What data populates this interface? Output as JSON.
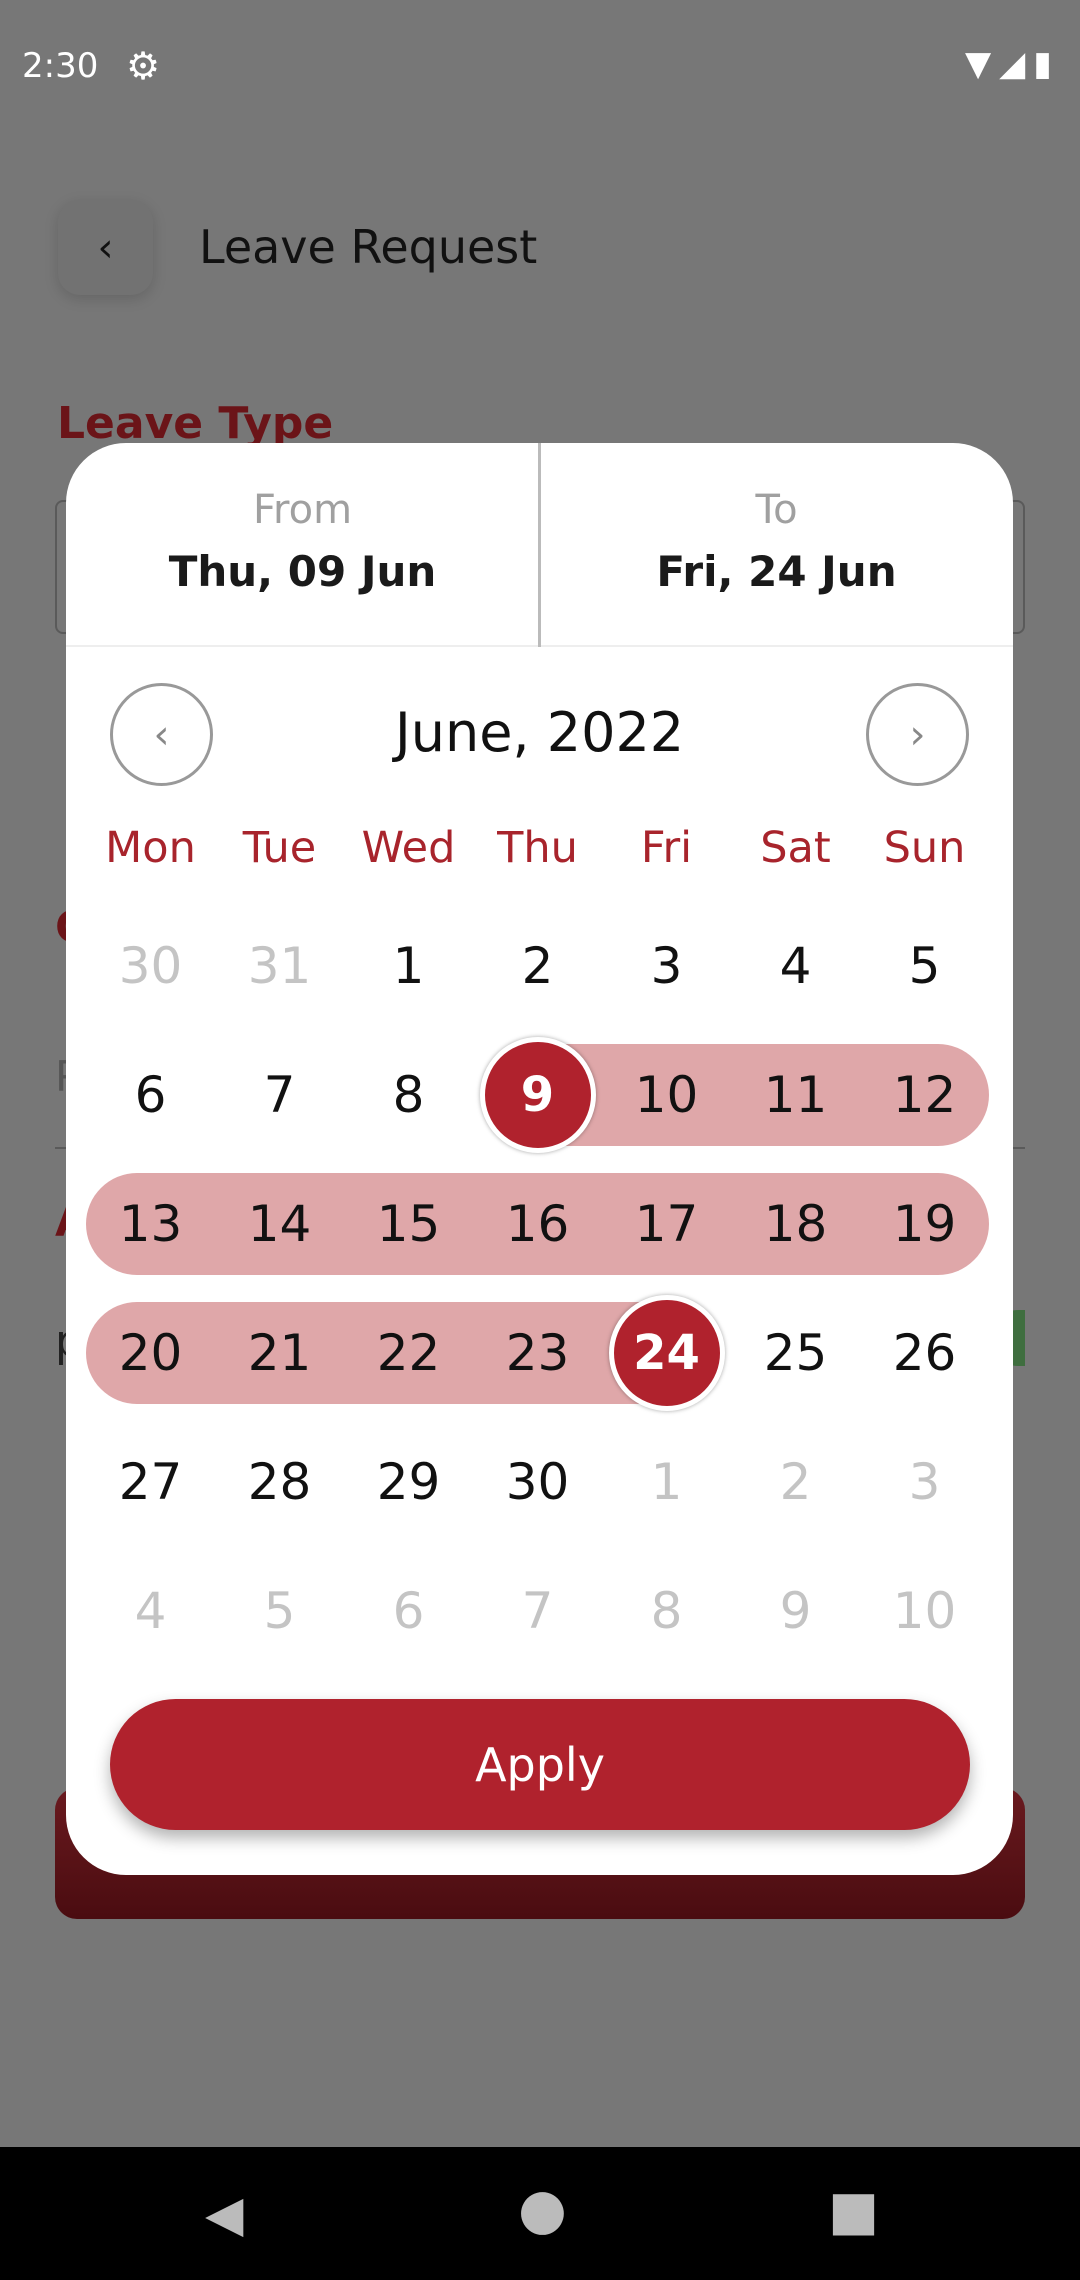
{
  "status_bar": {
    "time": "2:30",
    "settings_icon": "gear-icon",
    "wifi_icon": "wifi-icon",
    "signal_icon": "signal-icon",
    "battery_icon": "battery-icon"
  },
  "header": {
    "title": "Leave Request",
    "back_icon": "chevron-left-icon"
  },
  "background": {
    "leave_type_label": "Leave Type",
    "fragment_c": "C",
    "fragment_p": "P",
    "fragment_a": "A",
    "fragment_p2": "p"
  },
  "picker": {
    "from_label": "From",
    "from_value": "Thu, 09 Jun",
    "to_label": "To",
    "to_value": "Fri, 24 Jun",
    "month_title": "June, 2022",
    "weekdays": [
      "Mon",
      "Tue",
      "Wed",
      "Thu",
      "Fri",
      "Sat",
      "Sun"
    ],
    "weeks": [
      [
        "30",
        "31",
        "1",
        "2",
        "3",
        "4",
        "5"
      ],
      [
        "6",
        "7",
        "8",
        "9",
        "10",
        "11",
        "12"
      ],
      [
        "13",
        "14",
        "15",
        "16",
        "17",
        "18",
        "19"
      ],
      [
        "20",
        "21",
        "22",
        "23",
        "24",
        "25",
        "26"
      ],
      [
        "27",
        "28",
        "29",
        "30",
        "1",
        "2",
        "3"
      ],
      [
        "4",
        "5",
        "6",
        "7",
        "8",
        "9",
        "10"
      ]
    ],
    "range_start": "9",
    "range_end": "24",
    "apply_label": "Apply"
  },
  "colors": {
    "accent": "#b0222d",
    "range": "#dfa7a9",
    "weekday": "#a8242c"
  }
}
